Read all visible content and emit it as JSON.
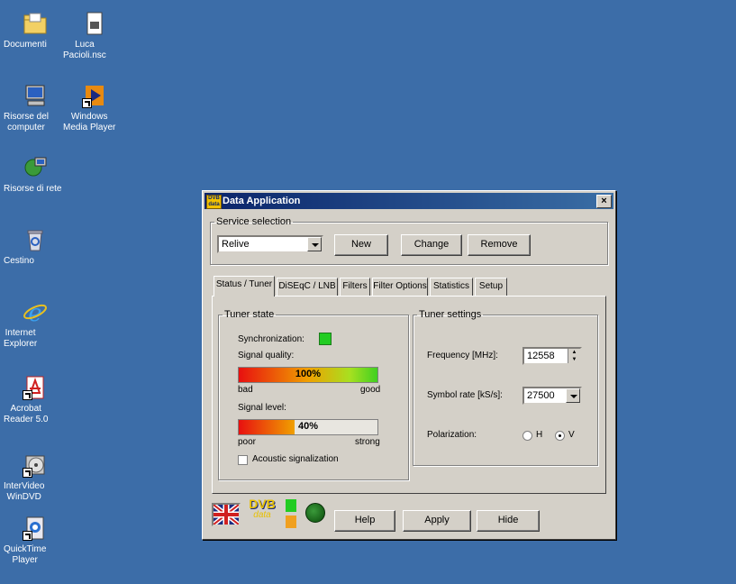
{
  "desktop": {
    "icons": [
      {
        "label": "Documenti"
      },
      {
        "label": "Luca\nPacioli.nsc"
      },
      {
        "label": "Risorse del\ncomputer"
      },
      {
        "label": "Windows\nMedia Player"
      },
      {
        "label": "Risorse di rete"
      },
      {
        "label": "Cestino"
      },
      {
        "label": "Internet\nExplorer"
      },
      {
        "label": "Acrobat\nReader 5.0"
      },
      {
        "label": "InterVideo\nWinDVD"
      },
      {
        "label": "QuickTime\nPlayer"
      }
    ]
  },
  "window": {
    "title": "Data Application",
    "close_label": "×",
    "service": {
      "legend": "Service selection",
      "selected": "Relive",
      "new_label": "New",
      "change_label": "Change",
      "remove_label": "Remove"
    },
    "tabs": [
      "Status / Tuner",
      "DiSEqC / LNB",
      "Filters",
      "Filter Options",
      "Statistics",
      "Setup"
    ],
    "tuner_state": {
      "legend": "Tuner state",
      "sync_label": "Synchronization:",
      "quality_label": "Signal quality:",
      "quality_value": "100%",
      "quality_fraction": 1.0,
      "quality_low": "bad",
      "quality_high": "good",
      "level_label": "Signal level:",
      "level_value": "40%",
      "level_fraction": 0.4,
      "level_low": "poor",
      "level_high": "strong",
      "acoustic_label": "Acoustic signalization"
    },
    "tuner_settings": {
      "legend": "Tuner settings",
      "frequency_label": "Frequency [MHz]:",
      "frequency_value": "12558",
      "symbol_label": "Symbol rate [kS/s]:",
      "symbol_value": "27500",
      "polarization_label": "Polarization:",
      "pol_h": "H",
      "pol_v": "V",
      "pol_selected": "V"
    },
    "footer": {
      "logo_text": "DVB",
      "logo_sub": "data",
      "help_label": "Help",
      "apply_label": "Apply",
      "hide_label": "Hide"
    }
  },
  "colors": {
    "desktop": "#3c6da8",
    "titlebar": "#0a246a",
    "sync_ok": "#22cc22",
    "status_green": "#22cc22",
    "status_orange": "#f0a020"
  }
}
